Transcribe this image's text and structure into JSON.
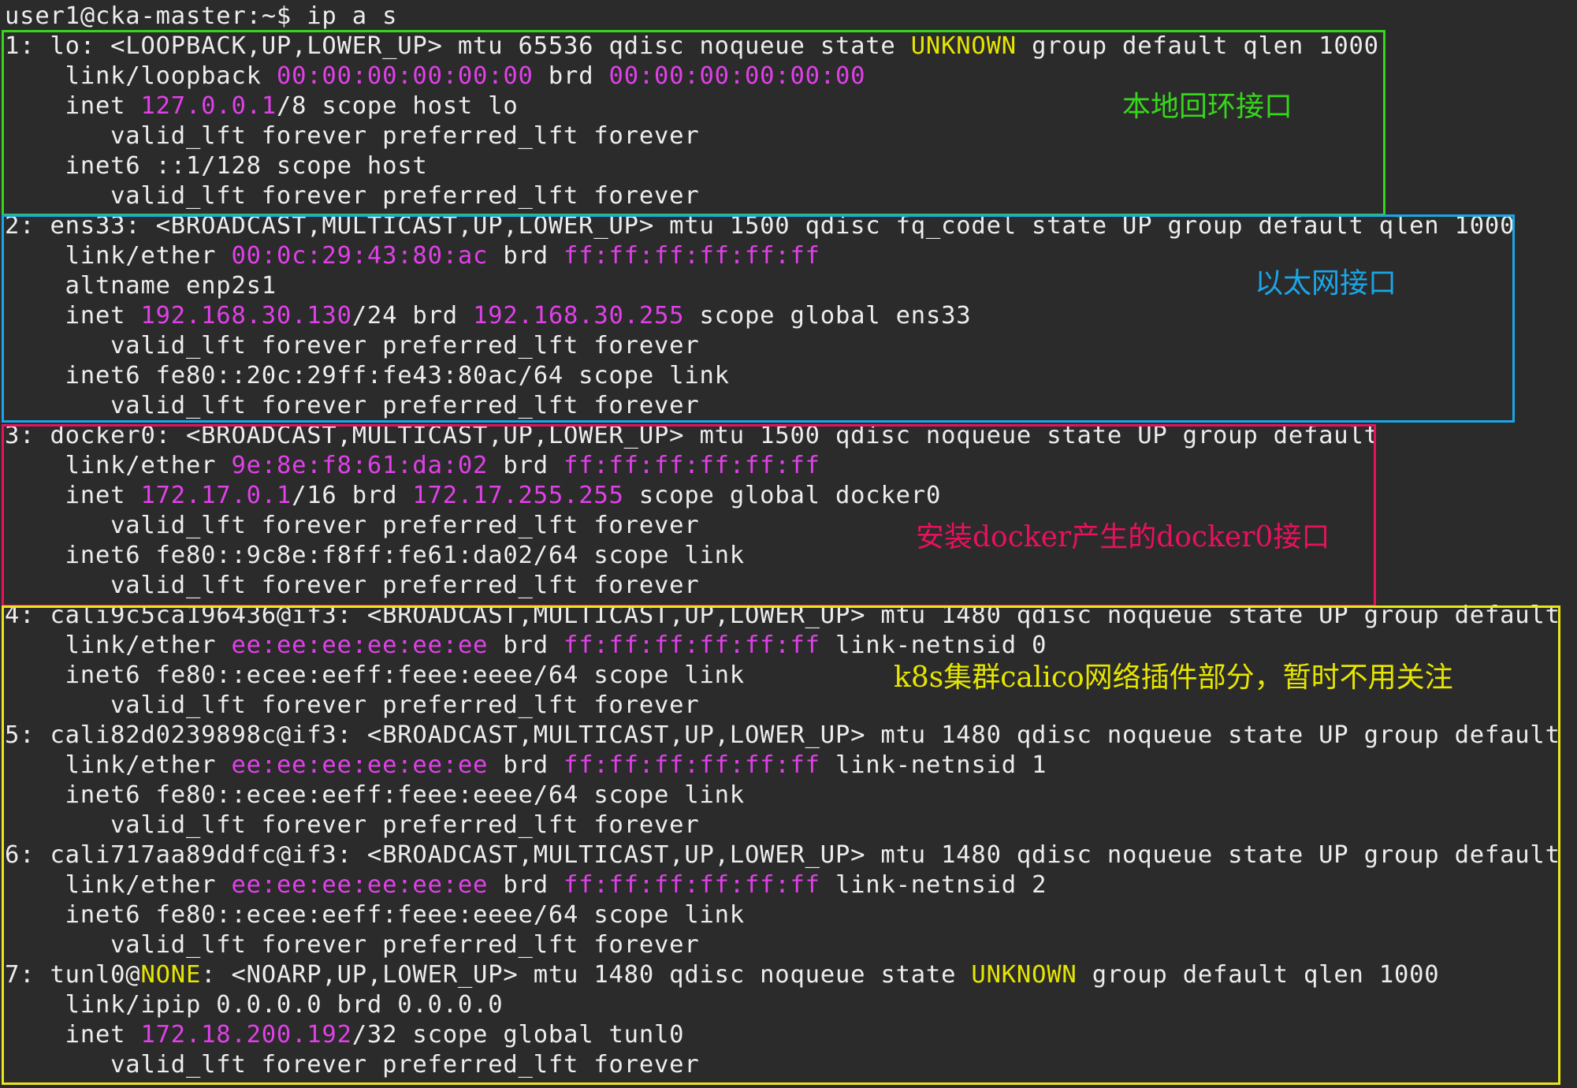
{
  "colors": {
    "background": "#2b2b2b",
    "text": "#ededed",
    "address": "#e040e8",
    "state_highlight": "#e6e600",
    "box_loopback": "#36d61a",
    "box_ethernet": "#1aa6e8",
    "box_docker": "#e8115e",
    "box_calico": "#ebe51e"
  },
  "prompt": {
    "text": "user1@cka-master:~$ ip a s"
  },
  "lines": [
    [
      "1: lo: <LOOPBACK,UP,LOWER_UP> mtu 65536 qdisc noqueue state ",
      "UNKNOWN",
      " group default qlen 1000"
    ],
    [
      "    link/loopback ",
      "00:00:00:00:00:00",
      " brd ",
      "00:00:00:00:00:00"
    ],
    [
      "    inet ",
      "127.0.0.1",
      "/8 scope host lo"
    ],
    [
      "       valid_lft forever preferred_lft forever"
    ],
    [
      "    inet6 ::1/128 scope host"
    ],
    [
      "       valid_lft forever preferred_lft forever"
    ],
    [
      "2: ens33: <BROADCAST,MULTICAST,UP,LOWER_UP> mtu 1500 qdisc fq_codel state UP group default qlen 1000"
    ],
    [
      "    link/ether ",
      "00:0c:29:43:80:ac",
      " brd ",
      "ff:ff:ff:ff:ff:ff"
    ],
    [
      "    altname enp2s1"
    ],
    [
      "    inet ",
      "192.168.30.130",
      "/24 brd ",
      "192.168.30.255",
      " scope global ens33"
    ],
    [
      "       valid_lft forever preferred_lft forever"
    ],
    [
      "    inet6 fe80::20c:29ff:fe43:80ac/64 scope link"
    ],
    [
      "       valid_lft forever preferred_lft forever"
    ],
    [
      "3: docker0: <BROADCAST,MULTICAST,UP,LOWER_UP> mtu 1500 qdisc noqueue state UP group default"
    ],
    [
      "    link/ether ",
      "9e:8e:f8:61:da:02",
      " brd ",
      "ff:ff:ff:ff:ff:ff"
    ],
    [
      "    inet ",
      "172.17.0.1",
      "/16 brd ",
      "172.17.255.255",
      " scope global docker0"
    ],
    [
      "       valid_lft forever preferred_lft forever"
    ],
    [
      "    inet6 fe80::9c8e:f8ff:fe61:da02/64 scope link"
    ],
    [
      "       valid_lft forever preferred_lft forever"
    ],
    [
      "4: cali9c5ca196436@if3: <BROADCAST,MULTICAST,UP,LOWER_UP> mtu 1480 qdisc noqueue state UP group default"
    ],
    [
      "    link/ether ",
      "ee:ee:ee:ee:ee:ee",
      " brd ",
      "ff:ff:ff:ff:ff:ff",
      " link-netnsid 0"
    ],
    [
      "    inet6 fe80::ecee:eeff:feee:eeee/64 scope link"
    ],
    [
      "       valid_lft forever preferred_lft forever"
    ],
    [
      "5: cali82d0239898c@if3: <BROADCAST,MULTICAST,UP,LOWER_UP> mtu 1480 qdisc noqueue state UP group default"
    ],
    [
      "    link/ether ",
      "ee:ee:ee:ee:ee:ee",
      " brd ",
      "ff:ff:ff:ff:ff:ff",
      " link-netnsid 1"
    ],
    [
      "    inet6 fe80::ecee:eeff:feee:eeee/64 scope link"
    ],
    [
      "       valid_lft forever preferred_lft forever"
    ],
    [
      "6: cali717aa89ddfc@if3: <BROADCAST,MULTICAST,UP,LOWER_UP> mtu 1480 qdisc noqueue state UP group default"
    ],
    [
      "    link/ether ",
      "ee:ee:ee:ee:ee:ee",
      " brd ",
      "ff:ff:ff:ff:ff:ff",
      " link-netnsid 2"
    ],
    [
      "    inet6 fe80::ecee:eeff:feee:eeee/64 scope link"
    ],
    [
      "       valid_lft forever preferred_lft forever"
    ],
    [
      "7: tunl0@",
      "NONE",
      ": <NOARP,UP,LOWER_UP> mtu 1480 qdisc noqueue state ",
      "UNKNOWN",
      " group default qlen 1000"
    ],
    [
      "    link/ipip 0.0.0.0 brd 0.0.0.0"
    ],
    [
      "    inet ",
      "172.18.200.192",
      "/32 scope global tunl0"
    ],
    [
      "       valid_lft forever preferred_lft forever"
    ]
  ],
  "annotations": {
    "loopback": "本地回环接口",
    "ethernet": "以太网接口",
    "docker": "安装docker产生的docker0接口",
    "calico": "k8s集群calico网络插件部分，暂时不用关注"
  }
}
